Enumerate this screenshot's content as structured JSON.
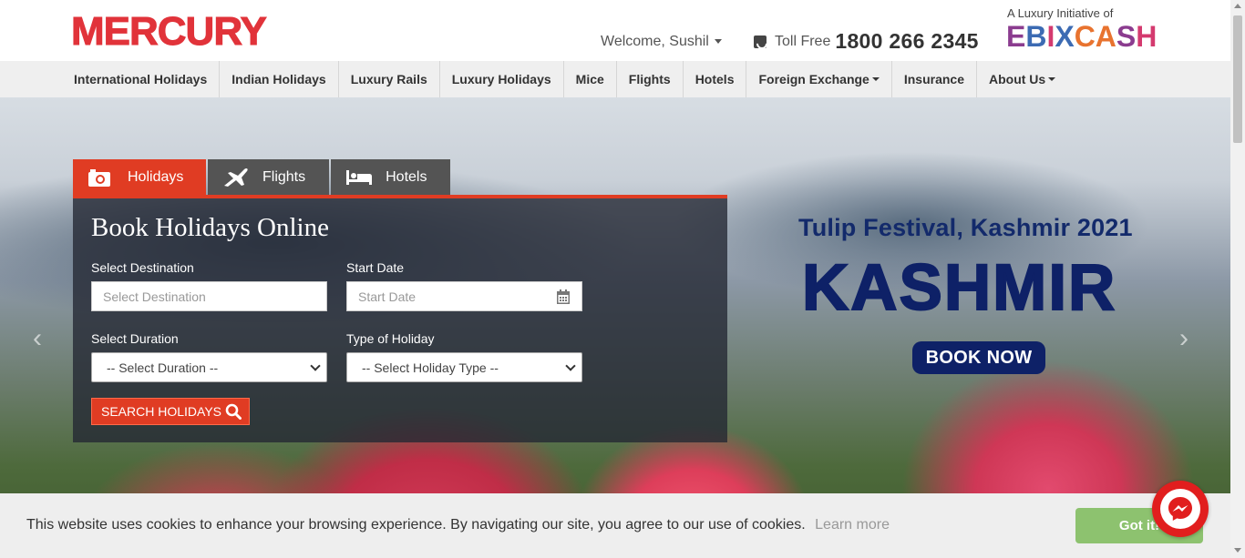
{
  "header": {
    "logo": "MERCURY",
    "welcome": "Welcome, Sushil",
    "tollfree_label": "Toll Free",
    "tollfree_number": "1800 266 2345",
    "partner_caption": "A Luxury Initiative of",
    "partner_logo": "EBIXCASH"
  },
  "nav": {
    "items": [
      {
        "label": "International Holidays"
      },
      {
        "label": "Indian Holidays"
      },
      {
        "label": "Luxury Rails"
      },
      {
        "label": "Luxury Holidays"
      },
      {
        "label": "Mice"
      },
      {
        "label": "Flights"
      },
      {
        "label": "Hotels"
      },
      {
        "label": "Foreign Exchange"
      },
      {
        "label": "Insurance"
      },
      {
        "label": "About Us"
      }
    ]
  },
  "banner": {
    "subtitle": "Tulip Festival, Kashmir 2021",
    "title": "KASHMIR",
    "button": "BOOK NOW"
  },
  "search": {
    "tabs": [
      {
        "label": "Holidays",
        "icon": "camera-icon"
      },
      {
        "label": "Flights",
        "icon": "plane-icon"
      },
      {
        "label": "Hotels",
        "icon": "bed-icon"
      }
    ],
    "heading": "Book Holidays Online",
    "destination_label": "Select Destination",
    "destination_placeholder": "Select Destination",
    "start_date_label": "Start Date",
    "start_date_placeholder": "Start Date",
    "duration_label": "Select Duration",
    "duration_value": "-- Select Duration --",
    "holiday_type_label": "Type of Holiday",
    "holiday_type_value": "-- Select Holiday Type --",
    "button": "SEARCH HOLIDAYS"
  },
  "cookie": {
    "text": "This website uses cookies to enhance your browsing experience. By navigating our site, you agree to our use of cookies.",
    "link": "Learn more",
    "button": "Got it!"
  },
  "colors": {
    "brand_red": "#e1333a",
    "accent_orange": "#e03c23",
    "navy": "#0e2167",
    "cookie_green": "#8dc26f"
  }
}
